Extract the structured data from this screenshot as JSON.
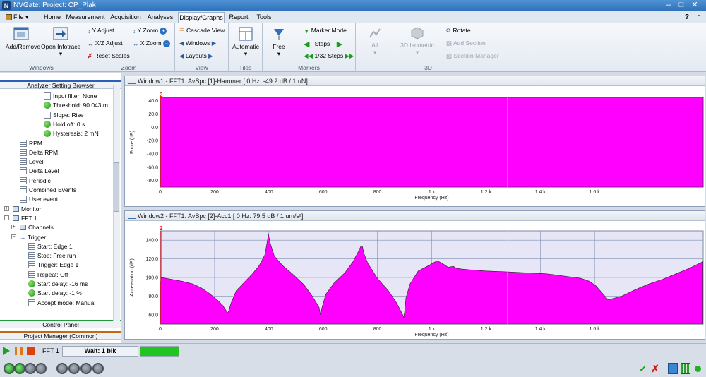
{
  "app": {
    "title": "NVGate: Project: CP_Plak"
  },
  "menu": {
    "file": "File",
    "tabs": [
      "Home",
      "Measurement",
      "Acquisition",
      "Analyses",
      "Display/Graphs",
      "Report",
      "Tools"
    ],
    "help": "?"
  },
  "ribbon": {
    "add_remove": "Add/Remove",
    "open_infotrace": "Open Infotrace",
    "windows_group": "Windows",
    "y_adjust": "Y Adjust",
    "xz_adjust": "X/Z Adjust",
    "reset_scales": "Reset Scales",
    "y_zoom": "Y Zoom",
    "x_zoom": "X Zoom",
    "zoom_group": "Zoom",
    "cascade_view": "Cascade View",
    "windows": "Windows",
    "layouts": "Layouts",
    "view_group": "View",
    "automatic": "Automatic",
    "tiles_group": "Tiles",
    "free": "Free",
    "marker_mode": "Marker Mode",
    "steps": "Steps",
    "steps_fraction": "1/32 Steps",
    "markers_group": "Markers",
    "all": "All",
    "iso": "3D Isometric",
    "rotate": "Rotate",
    "add_section": "Add Section",
    "section_manager": "Section Manager",
    "group_3d": "3D"
  },
  "left_panel": {
    "header": "Analyzer Setting Browser",
    "tree": [
      {
        "label": "Input filter: None",
        "icon": "settings"
      },
      {
        "label": "Threshold: 90.043 m",
        "icon": "green"
      },
      {
        "label": "Slope: Rise",
        "icon": "settings"
      },
      {
        "label": "Hold off: 0 s",
        "icon": "green"
      },
      {
        "label": "Hysteresis: 2 mN",
        "icon": "green"
      },
      {
        "label": "RPM",
        "icon": "settings"
      },
      {
        "label": "Delta RPM",
        "icon": "settings"
      },
      {
        "label": "Level",
        "icon": "settings"
      },
      {
        "label": "Delta Level",
        "icon": "settings"
      },
      {
        "label": "Periodic",
        "icon": "settings"
      },
      {
        "label": "Combined Events",
        "icon": "settings"
      },
      {
        "label": "User event",
        "icon": "settings"
      },
      {
        "label": "Monitor",
        "icon": "box"
      },
      {
        "label": "FFT 1",
        "icon": "box"
      },
      {
        "label": "Channels",
        "icon": "box"
      },
      {
        "label": "Trigger",
        "icon": "arrow"
      },
      {
        "label": "Start: Edge 1",
        "icon": "settings"
      },
      {
        "label": "Stop: Free run",
        "icon": "settings"
      },
      {
        "label": "Trigger: Edge 1",
        "icon": "settings"
      },
      {
        "label": "Repeat: Off",
        "icon": "settings"
      },
      {
        "label": "Start delay: -16 ms",
        "icon": "green"
      },
      {
        "label": "Start delay: -1 %",
        "icon": "green"
      },
      {
        "label": "Accept mode: Manual",
        "icon": "settings"
      }
    ],
    "control_panel": "Control Panel",
    "project_manager": "Project Manager (Common)"
  },
  "windows": [
    {
      "title": "Window1 - FFT1: AvSpc [1]-Hammer [ 0 Hz: -49.2 dB / 1 uN]",
      "ylabel": "Force (dB)",
      "xlabel": "Frequency (Hz)"
    },
    {
      "title": "Window2 - FFT1: AvSpc [2]-Acc1 [ 0 Hz: 79.5 dB / 1 um/s²]",
      "ylabel": "Acceleration (dB)",
      "xlabel": "Frequency (Hz)"
    }
  ],
  "chart_data": [
    {
      "type": "area",
      "title": "Window1 - FFT1: AvSpc [1]-Hammer [ 0 Hz: -49.2 dB / 1 uN]",
      "xlabel": "Frequency (Hz)",
      "ylabel": "Force (dB)",
      "xlim": [
        0,
        2000
      ],
      "ylim": [
        -90,
        45
      ],
      "x_ticks": [
        "0",
        "200",
        "400",
        "600",
        "800",
        "1 k",
        "1.2 k",
        "1.4 k",
        "1.6 k"
      ],
      "y_ticks": [
        "40.0",
        "20.0",
        "0.0",
        "-20.0",
        "-40.0",
        "-60.0",
        "-80.0"
      ],
      "marker_label": "2",
      "cursor_x": 1280,
      "series": [
        {
          "x": [
            0,
            2000
          ],
          "values": [
            45,
            45
          ]
        }
      ],
      "fill_color": "#ff00ff",
      "grid": true
    },
    {
      "type": "area",
      "title": "Window2 - FFT1: AvSpc [2]-Acc1 [ 0 Hz: 79.5 dB / 1 um/s²]",
      "xlabel": "Frequency (Hz)",
      "ylabel": "Acceleration (dB)",
      "xlim": [
        0,
        2000
      ],
      "ylim": [
        50,
        150
      ],
      "x_ticks": [
        "0",
        "200",
        "400",
        "600",
        "800",
        "1 k",
        "1.2 k",
        "1.4 k",
        "1.6 k"
      ],
      "y_ticks": [
        "140.0",
        "120.0",
        "100.0",
        "80.0",
        "60.0"
      ],
      "marker_label": "2",
      "cursor_x": 1280,
      "series": [
        {
          "x": [
            0,
            5,
            40,
            80,
            120,
            150,
            180,
            210,
            230,
            248,
            252,
            260,
            280,
            310,
            340,
            365,
            385,
            395,
            398,
            405,
            420,
            450,
            490,
            530,
            560,
            585,
            590,
            595,
            610,
            640,
            680,
            710,
            730,
            740,
            745,
            750,
            765,
            800,
            840,
            870,
            890,
            897,
            900,
            905,
            920,
            950,
            990,
            1020,
            1040,
            1050,
            1060,
            1080,
            1090,
            1110,
            1150,
            1200,
            1280,
            1350,
            1420,
            1450,
            1500,
            1530,
            1550,
            1580,
            1605,
            1650,
            1700,
            1750,
            1800,
            1850,
            1900,
            1950,
            1999
          ],
          "values": [
            94,
            100,
            98,
            96,
            93,
            89,
            83,
            76,
            70,
            62,
            64,
            72,
            86,
            95,
            104,
            113,
            124,
            140,
            147,
            137,
            123,
            113,
            103,
            92,
            80,
            68,
            60,
            67,
            82,
            94,
            105,
            117,
            128,
            134,
            133,
            126,
            115,
            99,
            86,
            73,
            62,
            57,
            63,
            78,
            93,
            107,
            113,
            118,
            115,
            113,
            111,
            112,
            110,
            109,
            108,
            107,
            106,
            105,
            104,
            103,
            101,
            100,
            99,
            96,
            91,
            76,
            80,
            87,
            93,
            98,
            104,
            110,
            117
          ]
        }
      ],
      "fill_color": "#ff00ff",
      "grid": true
    }
  ],
  "status": {
    "fft_label": "FFT 1",
    "wait_label": "Wait: 1 blk",
    "progress": 1.0
  }
}
